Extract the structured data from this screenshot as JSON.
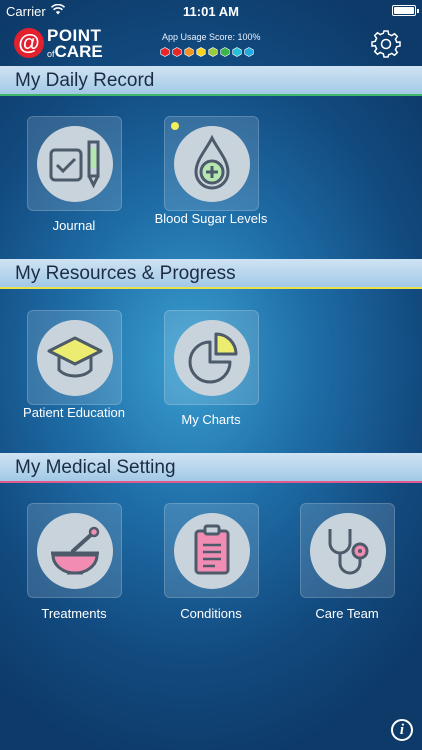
{
  "status_bar": {
    "carrier": "Carrier",
    "time": "11:01 AM"
  },
  "header": {
    "logo_at": "@",
    "logo_line1": "POINT",
    "logo_line2_small": "of",
    "logo_line2": "CARE",
    "score_label": "App Usage Score: 100%",
    "score_dots": [
      "#e8262a",
      "#e8262a",
      "#f29321",
      "#f7d21c",
      "#9ccc3b",
      "#3bb54a",
      "#27c0d8",
      "#1fa9e0"
    ]
  },
  "sections": [
    {
      "title": "My Daily Record",
      "line_color": "#3fb86a",
      "items": [
        {
          "label": "Journal",
          "icon": "journal-icon"
        },
        {
          "label": "Blood Sugar Levels",
          "icon": "blood-drop-icon"
        }
      ]
    },
    {
      "title": "My Resources & Progress",
      "line_color": "#e8e14a",
      "items": [
        {
          "label": "Patient Education",
          "icon": "graduation-cap-icon"
        },
        {
          "label": "My Charts",
          "icon": "pie-chart-icon"
        }
      ]
    },
    {
      "title": "My Medical Setting",
      "line_color": "#e05a8f",
      "items": [
        {
          "label": "Treatments",
          "icon": "mortar-pestle-icon"
        },
        {
          "label": "Conditions",
          "icon": "clipboard-icon"
        },
        {
          "label": "Care Team",
          "icon": "stethoscope-icon"
        }
      ]
    }
  ],
  "footer": {
    "info_glyph": "i"
  }
}
